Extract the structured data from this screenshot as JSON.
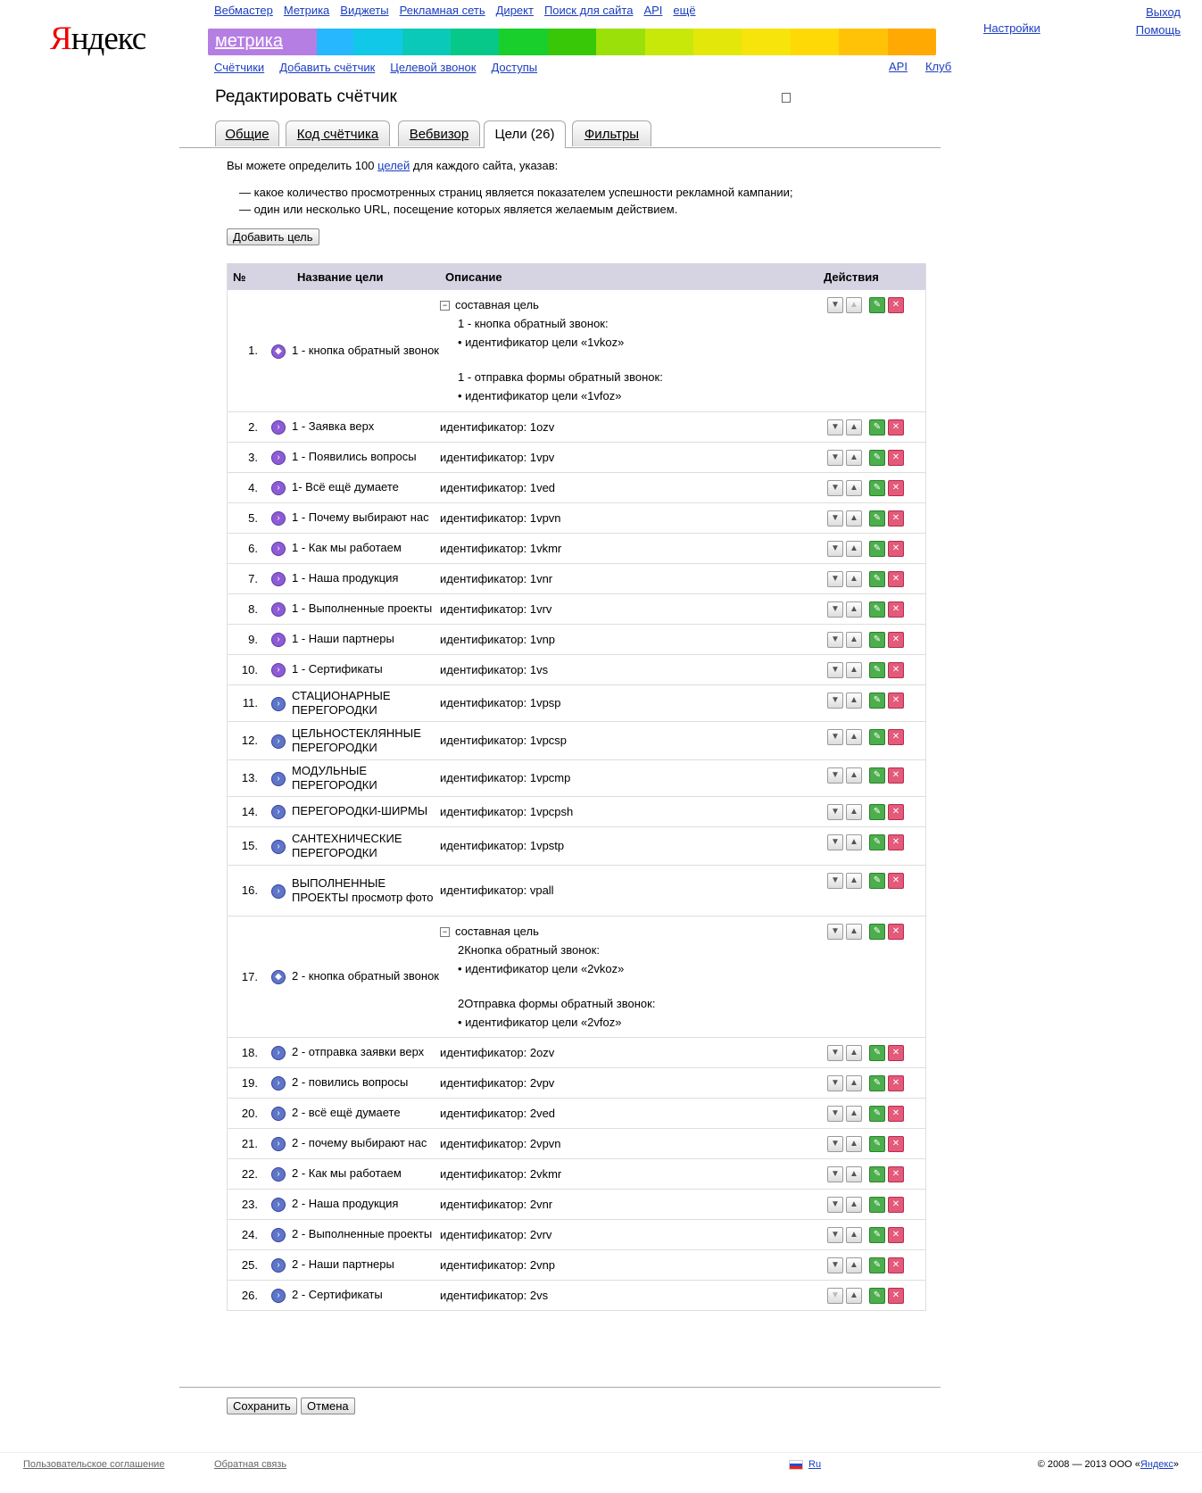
{
  "header": {
    "logo_text": "Яндекс",
    "services": [
      "Вебмастер",
      "Метрика",
      "Виджеты",
      "Рекламная сеть",
      "Директ",
      "Поиск для сайта",
      "API",
      "ещё"
    ],
    "metrika_label": "метрика",
    "subnav": [
      "Счётчики",
      "Добавить счётчик",
      "Целевой звонок",
      "Доступы"
    ],
    "subnav_right": [
      "API",
      "Клуб"
    ],
    "settings": "Настройки",
    "exit": "Выход",
    "help": "Помощь",
    "rainbow_colors": [
      "#6cb8ff",
      "#5cc0ff",
      "#27b7ff",
      "#12c8e8",
      "#0bc9b9",
      "#07c889",
      "#18cf2c",
      "#38c808",
      "#9be008",
      "#c8e80a",
      "#e4e70a",
      "#f7e40a",
      "#ffd906",
      "#ffc206",
      "#ffa902"
    ]
  },
  "page": {
    "title": "Редактировать счётчик",
    "tabs": [
      "Общие",
      "Код счётчика",
      "Вебвизор",
      "Цели (26)",
      "Фильтры"
    ],
    "active_tab": "Цели (26)"
  },
  "intro": {
    "text_before": "Вы можете определить 100 ",
    "link": "целей",
    "text_after": " для каждого сайта, указав:",
    "bullets": [
      "— какое количество просмотренных страниц является показателем успешности рекламной кампании;",
      "— один или несколько URL, посещение которых является желаемым действием."
    ],
    "add_button": "Добавить цель"
  },
  "table": {
    "headers": [
      "№",
      "Название цели",
      "Описание",
      "Действия"
    ],
    "rows": [
      {
        "num": "1.",
        "name": "1 - кнопка обратный звонок",
        "type": "composite",
        "color": "purple",
        "title": "составная цель",
        "steps": [
          [
            "1 - кнопка обратный звонок:",
            "• идентификатор цели «1vkoz»"
          ],
          [
            "1 - отправка формы обратный звонок:",
            "• идентификатор цели «1vfoz»"
          ]
        ],
        "up_disabled": true
      },
      {
        "num": "2.",
        "name": "1 - Заявка верх",
        "desc": "идентификатор: 1ozv",
        "color": "purple"
      },
      {
        "num": "3.",
        "name": "1 - Появились вопросы",
        "desc": "идентификатор: 1vpv",
        "color": "purple"
      },
      {
        "num": "4.",
        "name": "1- Всё ещё думаете",
        "desc": "идентификатор: 1ved",
        "color": "purple"
      },
      {
        "num": "5.",
        "name": "1 - Почему выбирают нас",
        "desc": "идентификатор: 1vpvn",
        "color": "purple"
      },
      {
        "num": "6.",
        "name": "1 - Как мы работаем",
        "desc": "идентификатор: 1vkmr",
        "color": "purple"
      },
      {
        "num": "7.",
        "name": "1 - Наша продукция",
        "desc": "идентификатор: 1vnr",
        "color": "purple"
      },
      {
        "num": "8.",
        "name": "1 - Выполненные проекты",
        "desc": "идентификатор: 1vrv",
        "color": "purple"
      },
      {
        "num": "9.",
        "name": "1 - Наши партнеры",
        "desc": "идентификатор: 1vnp",
        "color": "purple"
      },
      {
        "num": "10.",
        "name": "1 - Сертификаты",
        "desc": "идентификатор: 1vs",
        "color": "purple"
      },
      {
        "num": "11.",
        "name": "СТАЦИОНАРНЫЕ ПЕРЕГОРОДКИ",
        "desc": "идентификатор: 1vpsp",
        "color": "blue"
      },
      {
        "num": "12.",
        "name": "ЦЕЛЬНОСТЕКЛЯННЫЕ ПЕРЕГОРОДКИ",
        "desc": "идентификатор: 1vpcsp",
        "color": "blue"
      },
      {
        "num": "13.",
        "name": "МОДУЛЬНЫЕ ПЕРЕГОРОДКИ",
        "desc": "идентификатор: 1vpcmp",
        "color": "blue"
      },
      {
        "num": "14.",
        "name": "ПЕРЕГОРОДКИ-ШИРМЫ",
        "desc": "идентификатор: 1vpcpsh",
        "color": "blue"
      },
      {
        "num": "15.",
        "name": "САНТЕХНИЧЕСКИЕ ПЕРЕГОРОДКИ",
        "desc": "идентификатор: 1vpstp",
        "color": "blue"
      },
      {
        "num": "16.",
        "name": "ВЫПОЛНЕННЫЕ ПРОЕКТЫ просмотр фото",
        "desc": "идентификатор: vpall",
        "color": "blue"
      },
      {
        "num": "17.",
        "name": "2 - кнопка обратный звонок",
        "type": "composite",
        "color": "blue",
        "title": "составная цель",
        "steps": [
          [
            "2Кнопка обратный звонок:",
            "• идентификатор цели «2vkoz»"
          ],
          [
            "2Отправка формы обратный звонок:",
            "• идентификатор цели «2vfoz»"
          ]
        ]
      },
      {
        "num": "18.",
        "name": "2 - отправка заявки верх",
        "desc": "идентификатор: 2ozv",
        "color": "blue"
      },
      {
        "num": "19.",
        "name": "2 - повились вопросы",
        "desc": "идентификатор: 2vpv",
        "color": "blue"
      },
      {
        "num": "20.",
        "name": "2 - всё ещё думаете",
        "desc": "идентификатор: 2ved",
        "color": "blue"
      },
      {
        "num": "21.",
        "name": "2 - почему выбирают нас",
        "desc": "идентификатор: 2vpvn",
        "color": "blue"
      },
      {
        "num": "22.",
        "name": "2 - Как мы работаем",
        "desc": "идентификатор: 2vkmr",
        "color": "blue"
      },
      {
        "num": "23.",
        "name": "2 - Наша продукция",
        "desc": "идентификатор: 2vnr",
        "color": "blue"
      },
      {
        "num": "24.",
        "name": "2 - Выполненные проекты",
        "desc": "идентификатор: 2vrv",
        "color": "blue"
      },
      {
        "num": "25.",
        "name": "2 - Наши партнеры",
        "desc": "идентификатор: 2vnp",
        "color": "blue"
      },
      {
        "num": "26.",
        "name": "2 - Сертификаты",
        "desc": "идентификатор: 2vs",
        "color": "blue",
        "down_disabled": true
      }
    ]
  },
  "buttons": {
    "save": "Сохранить",
    "cancel": "Отмена"
  },
  "footer": {
    "agreement": "Пользовательское соглашение",
    "feedback": "Обратная связь",
    "lang": "Ru",
    "copyright_prefix": "© 2008 — 2013 ООО «",
    "copyright_link": "Яндекс",
    "copyright_suffix": "»"
  }
}
